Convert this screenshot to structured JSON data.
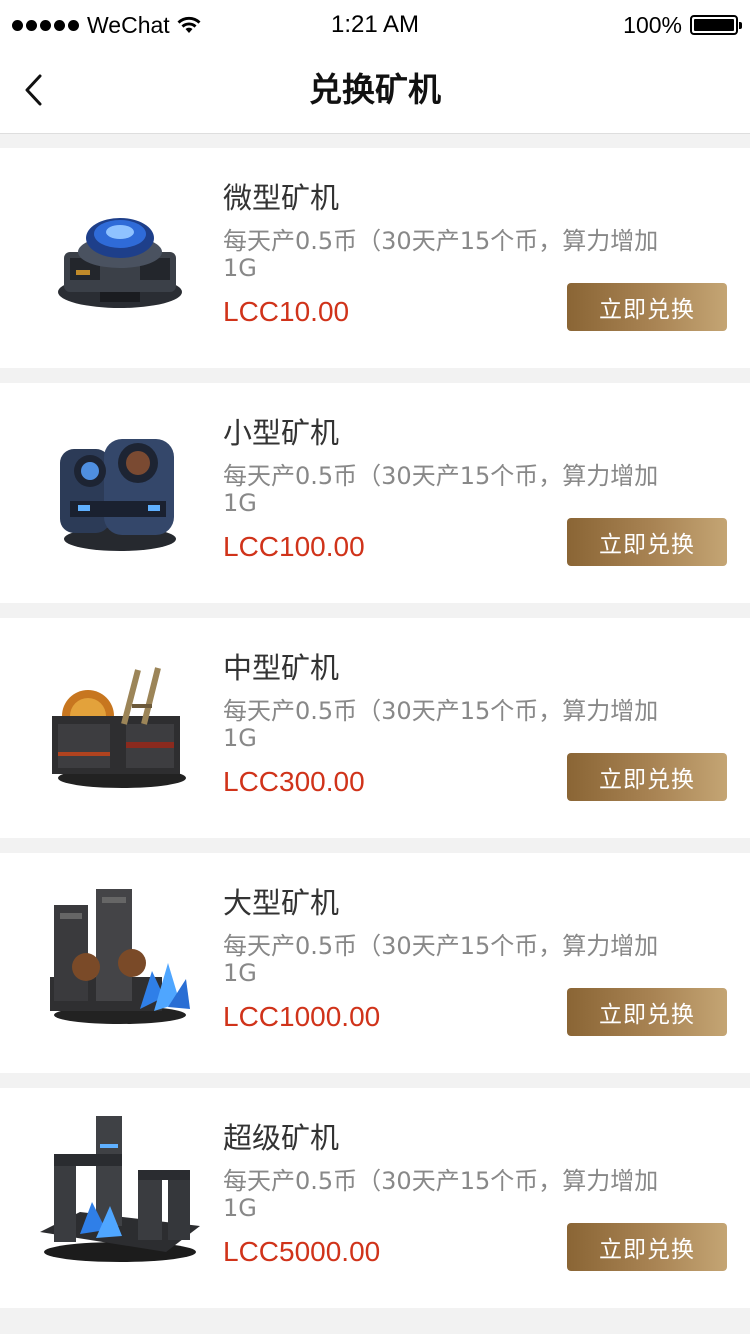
{
  "status_bar": {
    "carrier": "WeChat",
    "time": "1:21 AM",
    "battery": "100%"
  },
  "nav": {
    "title": "兑换矿机"
  },
  "items": [
    {
      "title": "微型矿机",
      "desc": "每天产0.5币（30天产15个币，算力增加1G",
      "price": "LCC10.00",
      "button": "立即兑换",
      "icon": "micro-miner-image"
    },
    {
      "title": "小型矿机",
      "desc": "每天产0.5币（30天产15个币，算力增加1G",
      "price": "LCC100.00",
      "button": "立即兑换",
      "icon": "small-miner-image"
    },
    {
      "title": "中型矿机",
      "desc": "每天产0.5币（30天产15个币，算力增加1G",
      "price": "LCC300.00",
      "button": "立即兑换",
      "icon": "medium-miner-image"
    },
    {
      "title": "大型矿机",
      "desc": "每天产0.5币（30天产15个币，算力增加1G",
      "price": "LCC1000.00",
      "button": "立即兑换",
      "icon": "large-miner-image"
    },
    {
      "title": "超级矿机",
      "desc": "每天产0.5币（30天产15个币，算力增加1G",
      "price": "LCC5000.00",
      "button": "立即兑换",
      "icon": "super-miner-image"
    }
  ],
  "colors": {
    "price": "#d0331a",
    "button_start": "#8a6535",
    "button_end": "#c4a574",
    "background": "#f2f2f2"
  }
}
